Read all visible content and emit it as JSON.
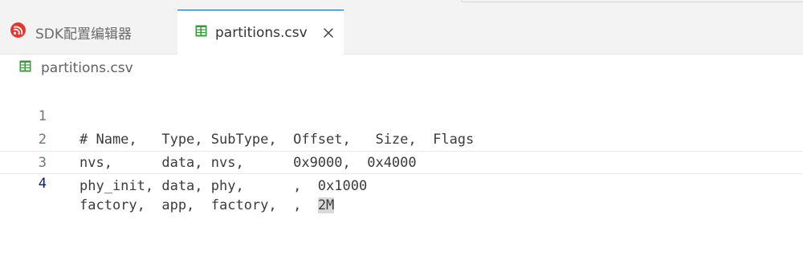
{
  "tabs": [
    {
      "label": "SDK配置编辑器",
      "icon": "espressif-logo-icon",
      "active": false
    },
    {
      "label": "partitions.csv",
      "icon": "csv-table-icon",
      "active": true
    }
  ],
  "breadcrumb": {
    "file": "partitions.csv",
    "icon": "csv-table-icon"
  },
  "editor": {
    "current_line": 4,
    "lines": [
      {
        "number": "1",
        "text": "# Name,   Type, SubType,  Offset,   Size,  Flags"
      },
      {
        "number": "2",
        "text": "nvs,      data, nvs,      0x9000,  0x4000"
      },
      {
        "number": "3",
        "text": "phy_init, data, phy,      ,  0x1000"
      },
      {
        "number": "4",
        "text_before": "factory,  app,  factory,  ,  ",
        "text_highlight": "2M"
      }
    ]
  },
  "colors": {
    "accent": "#005fb8",
    "espressif_red": "#e7352c",
    "csv_icon_green": "#3a9a3a"
  }
}
